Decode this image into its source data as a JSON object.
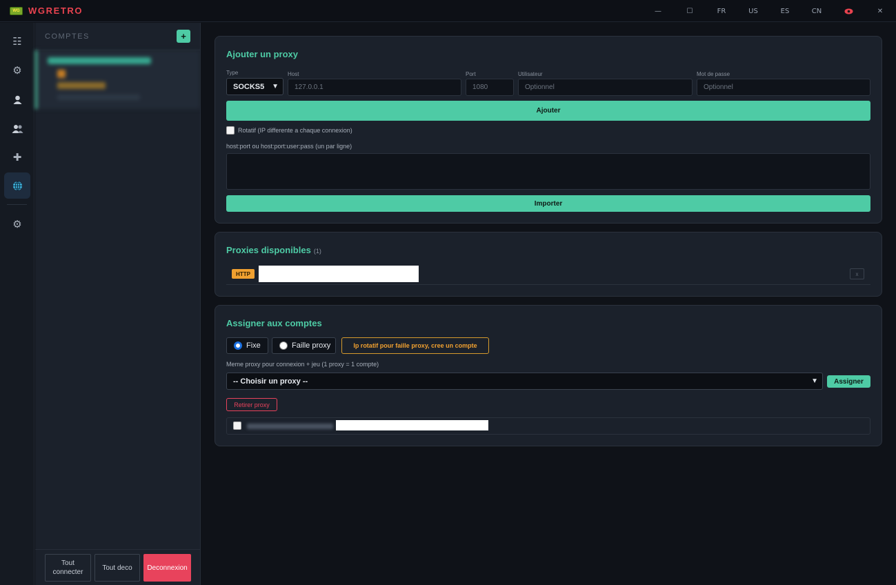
{
  "titlebar": {
    "logo_text": "WG",
    "app_title": "WGRETRO",
    "minimize": "—",
    "maximize": "☐",
    "langs": [
      "FR",
      "US",
      "ES",
      "CN"
    ],
    "eye_icon": "eye-icon",
    "close": "✕"
  },
  "rail": {
    "items": [
      {
        "icon": "list-icon",
        "glyph": "☷"
      },
      {
        "icon": "gear-icon",
        "glyph": "⚙"
      },
      {
        "icon": "user-icon",
        "glyph": "👤"
      },
      {
        "icon": "users-icon",
        "glyph": "👥"
      },
      {
        "icon": "plus-icon",
        "glyph": "✚"
      },
      {
        "icon": "globe-icon",
        "glyph": "🌐"
      },
      {
        "icon": "settings-icon",
        "glyph": "⚙"
      }
    ],
    "active": "globe-icon"
  },
  "sidebar": {
    "title": "COMPTES",
    "add": "+",
    "buttons": {
      "connect_all": "Tout connecter",
      "disconnect_all": "Tout deco",
      "logout": "Deconnexion"
    }
  },
  "add_proxy": {
    "title": "Ajouter un proxy",
    "type_label": "Type",
    "type_value": "SOCKS5",
    "host_label": "Host",
    "host_placeholder": "127.0.0.1",
    "port_label": "Port",
    "port_placeholder": "1080",
    "user_label": "Utilisateur",
    "user_placeholder": "Optionnel",
    "pass_label": "Mot de passe",
    "pass_placeholder": "Optionnel",
    "add_button": "Ajouter",
    "rotating_label": "Rotatif (IP differente a chaque connexion)",
    "import_label": "host:port ou host:port:user:pass (un par ligne)",
    "import_button": "Importer"
  },
  "available": {
    "title": "Proxies disponibles",
    "count": "(1)",
    "proxies": [
      {
        "type": "HTTP"
      }
    ],
    "remove": "x"
  },
  "assign": {
    "title": "Assigner aux comptes",
    "mode_fixed": "Fixe",
    "mode_failover": "Faille proxy",
    "warning": "Ip rotatif pour faille proxy, cree un compte",
    "help": "Meme proxy pour connexion + jeu (1 proxy = 1 compte)",
    "select_value": "-- Choisir un proxy --",
    "assign_button": "Assigner",
    "remove_button": "Retirer proxy"
  },
  "colors": {
    "accent": "#4ecba5",
    "danger": "#e8435c",
    "warning": "#f0a030"
  }
}
